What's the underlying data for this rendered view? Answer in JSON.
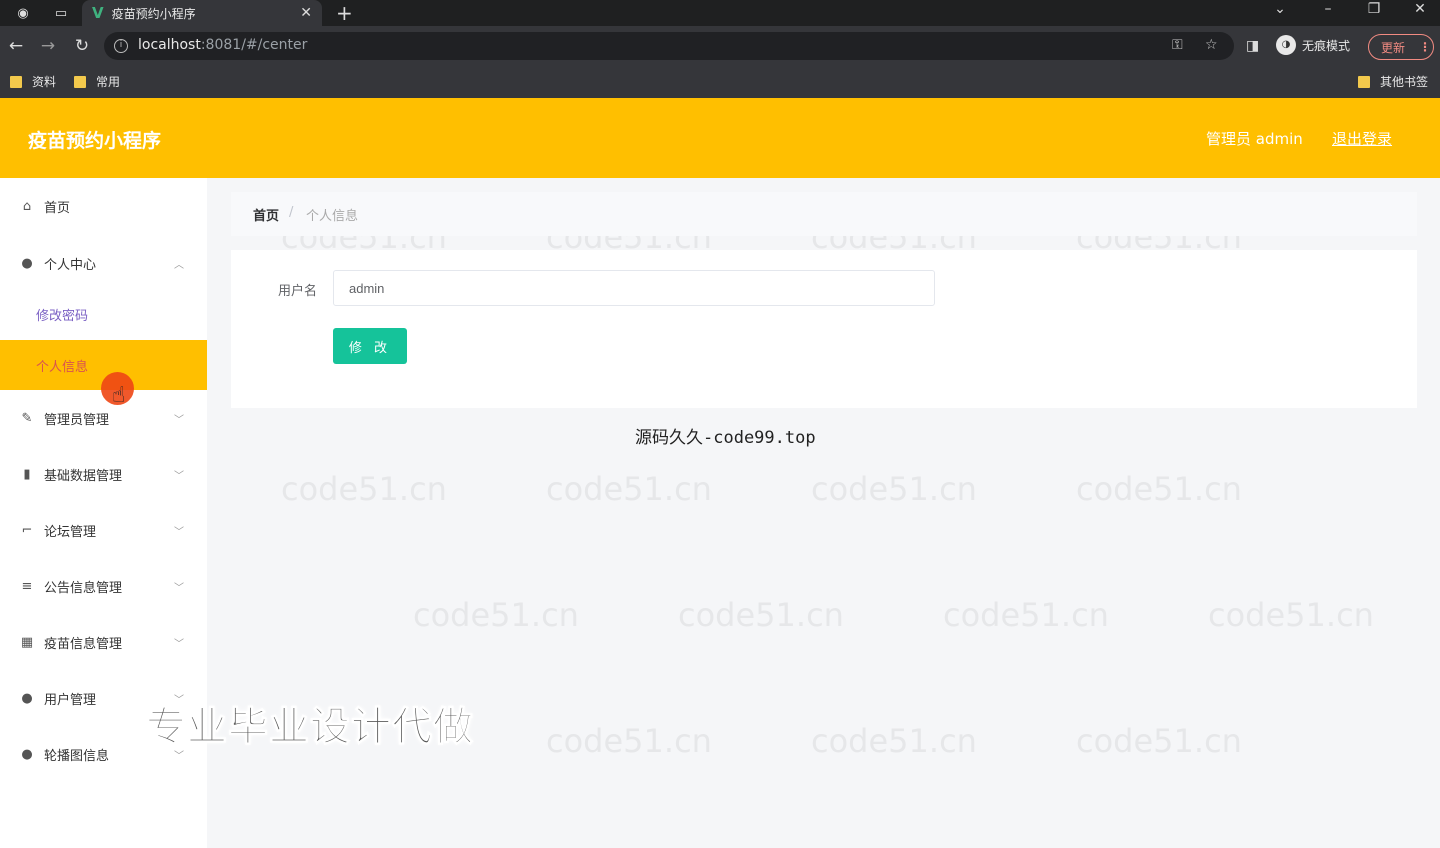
{
  "browser": {
    "tab_title": "疫苗预约小程序",
    "new_tab": "+",
    "url_host": "localhost",
    "url_rest": ":8081/#/center",
    "incognito_label": "无痕模式",
    "update_label": "更新",
    "bookmarks": [
      "资料",
      "常用"
    ],
    "other_bookmarks": "其他书签"
  },
  "header": {
    "title": "疫苗预约小程序",
    "user": "管理员 admin",
    "logout": "退出登录"
  },
  "sidebar": {
    "items": [
      {
        "label": "首页",
        "icon": "home-icon"
      },
      {
        "label": "个人中心",
        "icon": "user-icon"
      },
      {
        "label": "管理员管理",
        "icon": "pen-icon"
      },
      {
        "label": "基础数据管理",
        "icon": "chart-icon"
      },
      {
        "label": "论坛管理",
        "icon": "crop-icon"
      },
      {
        "label": "公告信息管理",
        "icon": "list-icon"
      },
      {
        "label": "疫苗信息管理",
        "icon": "grid-icon"
      },
      {
        "label": "用户管理",
        "icon": "user-icon"
      },
      {
        "label": "轮播图信息",
        "icon": "user-icon"
      }
    ],
    "subitems": [
      {
        "label": "修改密码"
      },
      {
        "label": "个人信息"
      }
    ]
  },
  "breadcrumb": {
    "home": "首页",
    "separator": "/",
    "current": "个人信息"
  },
  "form": {
    "username_label": "用户名",
    "username_value": "admin",
    "submit_label": "修 改"
  },
  "caption": "源码久久-code99.top",
  "overlay": "专业毕业设计代做",
  "watermark": "code51.cn",
  "colors": {
    "header": "#ffbf00",
    "button": "#15c39a",
    "active_sub_text": "#d9534f"
  }
}
